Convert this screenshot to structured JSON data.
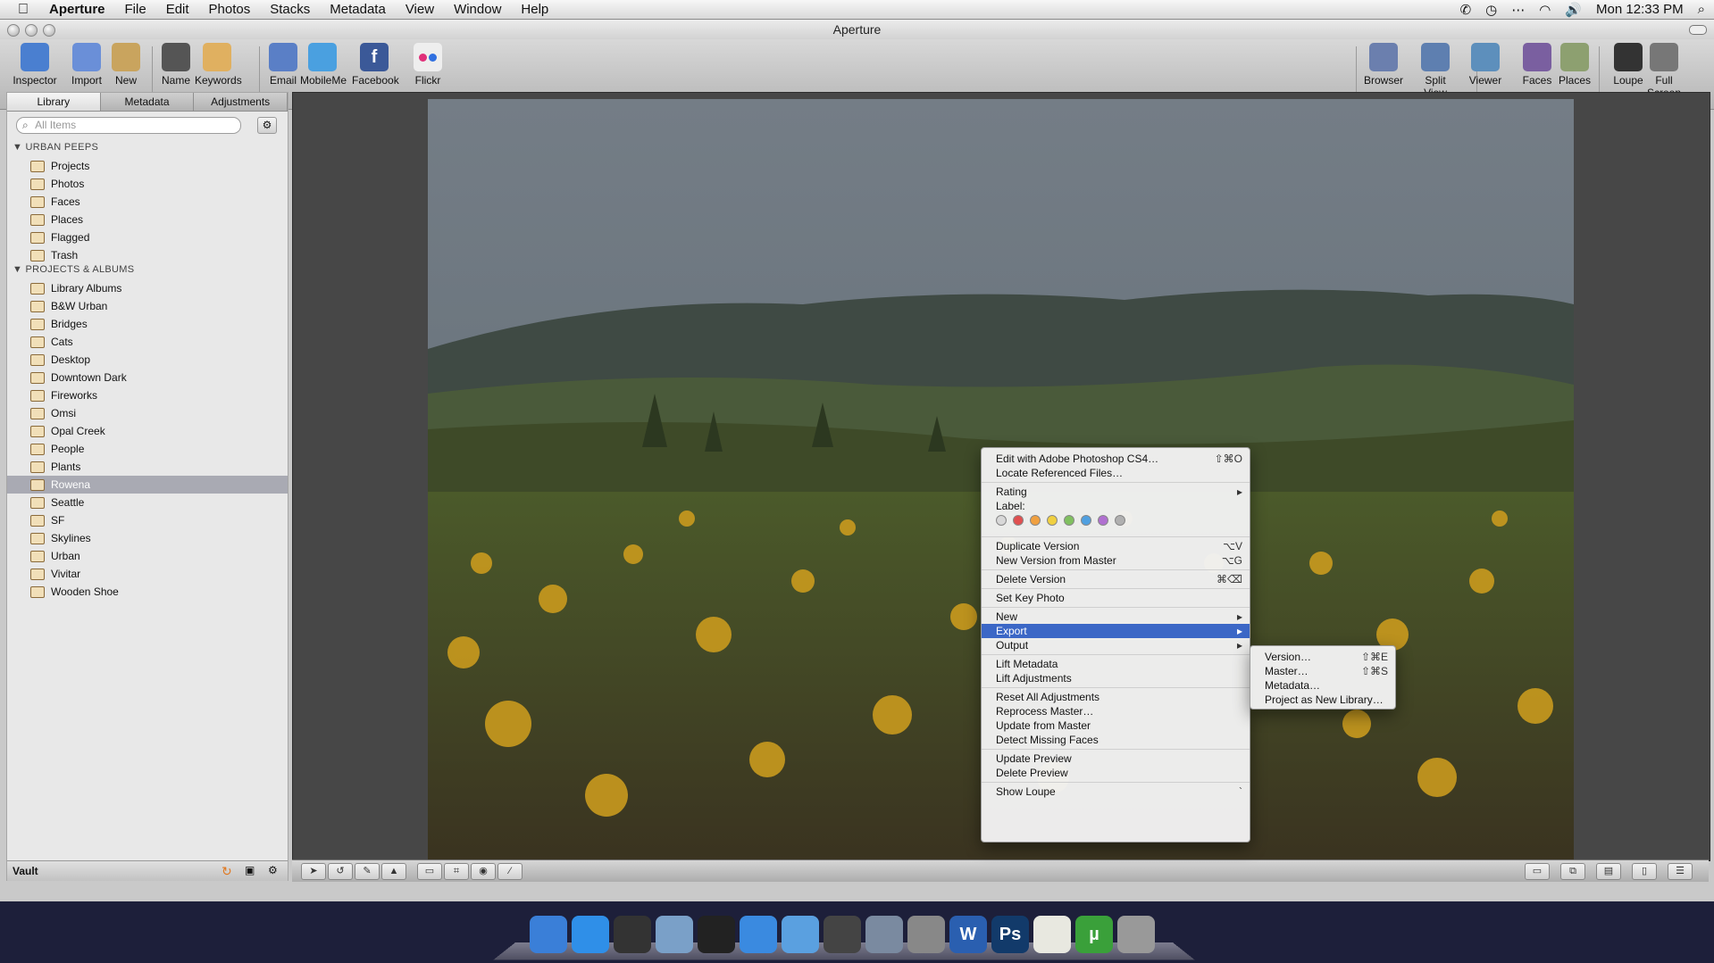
{
  "menubar": {
    "apple": "",
    "app": "Aperture",
    "items": [
      "File",
      "Edit",
      "Photos",
      "Stacks",
      "Metadata",
      "View",
      "Window",
      "Help"
    ],
    "clock": "Mon 12:33 PM"
  },
  "window": {
    "title": "Aperture"
  },
  "toolbar": {
    "left": [
      {
        "label": "Inspector",
        "icon": "info-icon",
        "color": "#4a7fd0"
      },
      {
        "label": "Import",
        "icon": "import-icon",
        "color": "#6a8fd8"
      },
      {
        "label": "New",
        "icon": "new-folder-icon",
        "color": "#c9a45e"
      },
      {
        "label": "Name",
        "icon": "name-badge-icon",
        "color": "#555"
      },
      {
        "label": "Keywords",
        "icon": "keyword-tag-icon",
        "color": "#e0b060"
      },
      {
        "label": "Email",
        "icon": "email-icon",
        "color": "#5a7fc6"
      },
      {
        "label": "MobileMe",
        "icon": "cloud-icon",
        "color": "#4aa0e0"
      },
      {
        "label": "Facebook",
        "icon": "facebook-icon",
        "color": "#3b5998",
        "glyph": "f"
      },
      {
        "label": "Flickr",
        "icon": "flickr-icon",
        "color": "#eeeeee"
      }
    ],
    "right": [
      {
        "label": "Browser",
        "icon": "grid-browser-icon",
        "color": "#6b7fae"
      },
      {
        "label": "Split View",
        "icon": "split-view-icon",
        "color": "#5e7fb0"
      },
      {
        "label": "Viewer",
        "icon": "viewer-icon",
        "color": "#5d8fbc"
      },
      {
        "label": "Faces",
        "icon": "faces-icon",
        "color": "#7a5fa0"
      },
      {
        "label": "Places",
        "icon": "places-icon",
        "color": "#8da070"
      },
      {
        "label": "Loupe",
        "icon": "loupe-icon",
        "color": "#333"
      },
      {
        "label": "Full Screen",
        "icon": "full-screen-icon",
        "color": "#777"
      }
    ]
  },
  "sidebar": {
    "tabs": [
      "Library",
      "Metadata",
      "Adjustments"
    ],
    "search_placeholder": "All Items",
    "sections": [
      {
        "title": "URBAN PEEPS",
        "items": [
          "Projects",
          "Photos",
          "Faces",
          "Places",
          "Flagged",
          "Trash"
        ]
      },
      {
        "title": "PROJECTS & ALBUMS",
        "items": [
          "Library Albums",
          "B&W Urban",
          "Bridges",
          "Cats",
          "Desktop",
          "Downtown Dark",
          "Fireworks",
          "Omsi",
          "Opal Creek",
          "People",
          "Plants",
          "Rowena",
          "Seattle",
          "SF",
          "Skylines",
          "Urban",
          "Vivitar",
          "Wooden Shoe"
        ]
      }
    ],
    "selected": "Rowena",
    "vault_label": "Vault"
  },
  "context_menu": {
    "items": [
      {
        "label": "Edit with Adobe Photoshop CS4…",
        "shortcut": "⇧⌘O"
      },
      {
        "label": "Locate Referenced Files…",
        "shortcut": ""
      },
      {
        "sep": true
      },
      {
        "label": "Rating",
        "shortcut": "▸"
      },
      {
        "label": "Label:",
        "shortcut": ""
      },
      {
        "dots": true
      },
      {
        "sep": true
      },
      {
        "label": "Duplicate Version",
        "shortcut": "⌥V"
      },
      {
        "label": "New Version from Master",
        "shortcut": "⌥G"
      },
      {
        "sep": true
      },
      {
        "label": "Delete Version",
        "shortcut": "⌘⌫"
      },
      {
        "sep": true
      },
      {
        "label": "Set Key Photo",
        "shortcut": ""
      },
      {
        "sep": true
      },
      {
        "label": "New",
        "shortcut": "▸"
      },
      {
        "label": "Export",
        "shortcut": "▸",
        "highlight": true
      },
      {
        "label": "Output",
        "shortcut": "▸"
      },
      {
        "sep": true
      },
      {
        "label": "Lift Metadata",
        "shortcut": ""
      },
      {
        "label": "Lift Adjustments",
        "shortcut": ""
      },
      {
        "sep": true
      },
      {
        "label": "Reset All Adjustments",
        "shortcut": ""
      },
      {
        "label": "Reprocess Master…",
        "shortcut": ""
      },
      {
        "label": "Update from Master",
        "shortcut": ""
      },
      {
        "label": "Detect Missing Faces",
        "shortcut": ""
      },
      {
        "sep": true
      },
      {
        "label": "Update Preview",
        "shortcut": ""
      },
      {
        "label": "Delete Preview",
        "shortcut": ""
      },
      {
        "sep": true
      },
      {
        "label": "Show Loupe",
        "shortcut": "`"
      }
    ],
    "label_colors": [
      "#d8d8d8",
      "#e05050",
      "#f0a040",
      "#f0d040",
      "#80c060",
      "#50a0e0",
      "#b070d0",
      "#b0b0b0"
    ]
  },
  "export_submenu": {
    "items": [
      {
        "label": "Version…",
        "shortcut": "⇧⌘E"
      },
      {
        "label": "Master…",
        "shortcut": "⇧⌘S"
      },
      {
        "label": "Metadata…",
        "shortcut": ""
      },
      {
        "label": "Project as New Library…",
        "shortcut": ""
      }
    ]
  },
  "dock": {
    "apps": [
      {
        "name": "finder-icon",
        "color": "#3a7fd8"
      },
      {
        "name": "app-store-icon",
        "color": "#2f8fe8"
      },
      {
        "name": "dashboard-icon",
        "color": "#333"
      },
      {
        "name": "preview-icon",
        "color": "#7aa0c8"
      },
      {
        "name": "aperture-icon",
        "color": "#222"
      },
      {
        "name": "itunes-icon",
        "color": "#3a8ae0"
      },
      {
        "name": "safari-icon",
        "color": "#5aa0e0"
      },
      {
        "name": "facetime-icon",
        "color": "#444"
      },
      {
        "name": "iphoto-icon",
        "color": "#7a8aa0"
      },
      {
        "name": "system-preferences-icon",
        "color": "#888"
      },
      {
        "name": "word-icon",
        "color": "#2a5fb0",
        "glyph": "W"
      },
      {
        "name": "photoshop-icon",
        "color": "#123a6a",
        "glyph": "Ps"
      },
      {
        "name": "textedit-icon",
        "color": "#e8e8e0"
      },
      {
        "name": "utorrent-icon",
        "color": "#3aa03a",
        "glyph": "µ"
      },
      {
        "name": "trash-icon",
        "color": "#999"
      }
    ]
  }
}
